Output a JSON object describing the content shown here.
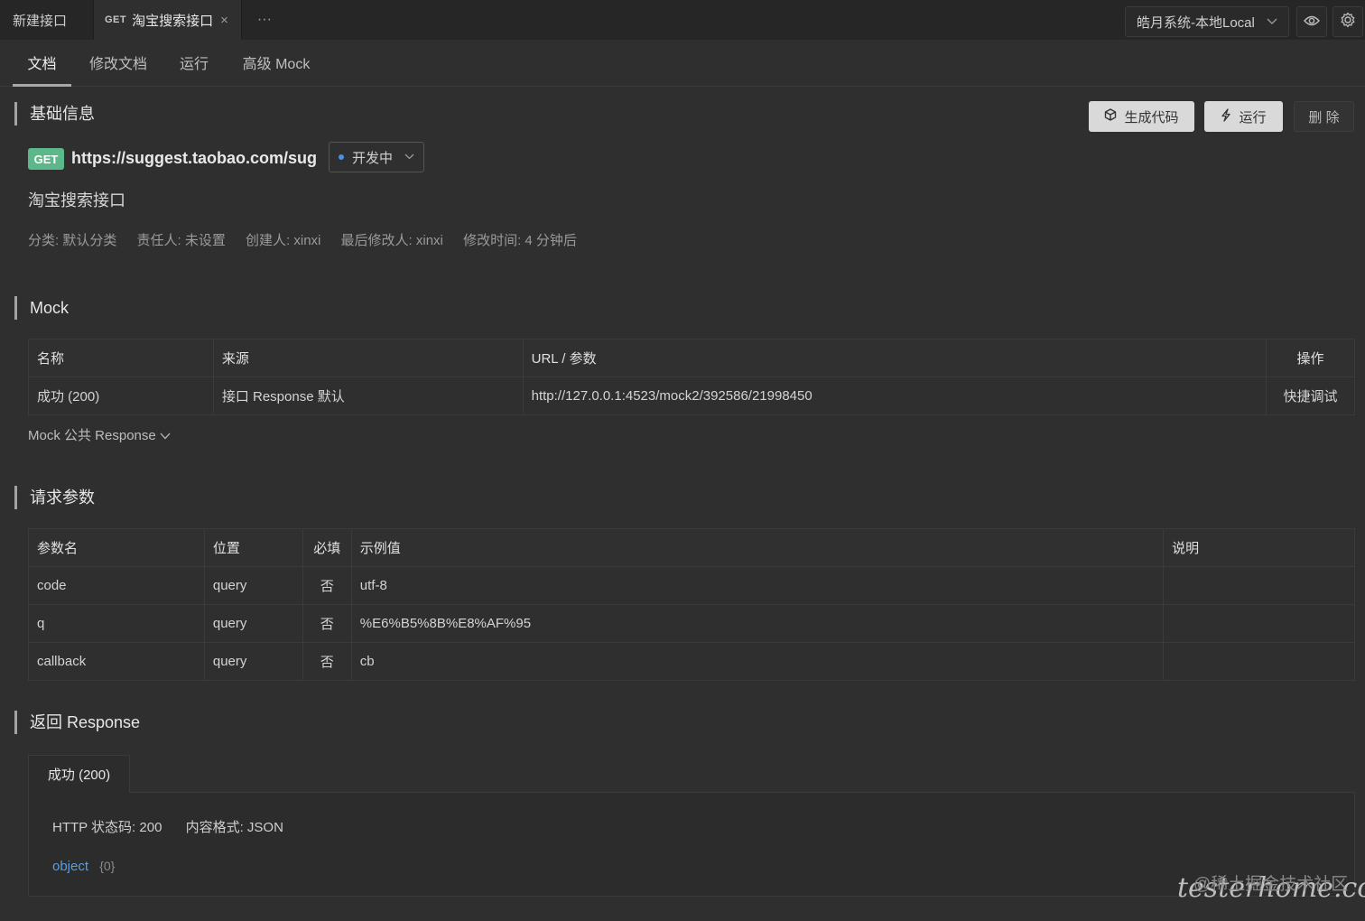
{
  "tabs": [
    {
      "label": "新建接口"
    },
    {
      "method": "GET",
      "label": "淘宝搜索接口",
      "close": "×"
    }
  ],
  "tab_more": "···",
  "environment": {
    "selected": "皓月系统-本地Local"
  },
  "subtabs": [
    "文档",
    "修改文档",
    "运行",
    "高级 Mock"
  ],
  "sections": {
    "basic": "基础信息",
    "mock": "Mock",
    "request_params": "请求参数",
    "response": "返回 Response"
  },
  "actions": {
    "generate_code": "生成代码",
    "run": "运行",
    "delete": "删 除"
  },
  "api": {
    "method": "GET",
    "url": "https://suggest.taobao.com/sug",
    "status": "开发中",
    "name": "淘宝搜索接口",
    "meta": {
      "category": "分类: 默认分类",
      "owner": "责任人: 未设置",
      "creator": "创建人: xinxi",
      "modifier": "最后修改人: xinxi",
      "modified_time": "修改时间: 4 分钟后"
    }
  },
  "mock_table": {
    "headers": [
      "名称",
      "来源",
      "URL / 参数",
      "操作"
    ],
    "rows": [
      {
        "name": "成功 (200)",
        "source": "接口 Response 默认",
        "url": "http://127.0.0.1:4523/mock2/392586/21998450",
        "action": "快捷调试"
      }
    ]
  },
  "mock_public": "Mock 公共 Response",
  "param_table": {
    "headers": [
      "参数名",
      "位置",
      "必填",
      "示例值",
      "说明"
    ],
    "rows": [
      {
        "name": "code",
        "in": "query",
        "required": "否",
        "example": "utf-8",
        "desc": ""
      },
      {
        "name": "q",
        "in": "query",
        "required": "否",
        "example": "%E6%B5%8B%E8%AF%95",
        "desc": ""
      },
      {
        "name": "callback",
        "in": "query",
        "required": "否",
        "example": "cb",
        "desc": ""
      }
    ]
  },
  "response": {
    "tab": "成功 (200)",
    "status_code": "HTTP 状态码: 200",
    "content_type": "内容格式: JSON",
    "type": "object",
    "count": "{0}"
  },
  "watermark": {
    "text": "@稀土掘金技术社区",
    "script": "testerhome.com"
  }
}
